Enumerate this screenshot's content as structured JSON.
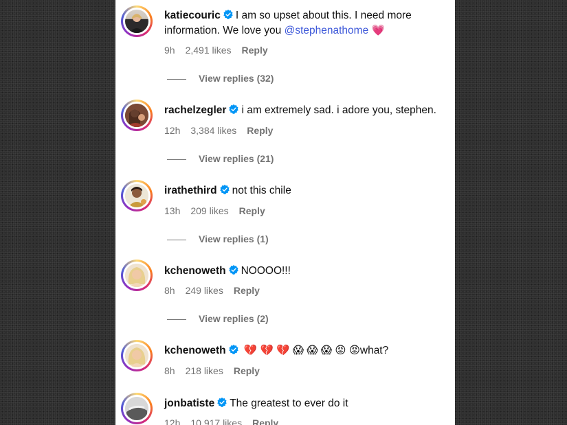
{
  "comments": [
    {
      "username": "katiecouric",
      "text_line1": "I am so upset about this. I need more",
      "text_line2": "information. We love you ",
      "mention": "@stephenathome",
      "emoji": "💗",
      "time": "9h",
      "likes": "2,491 likes",
      "reply": "Reply",
      "view_replies": "View replies (32)"
    },
    {
      "username": "rachelzegler",
      "text": "i am extremely sad. i adore you, stephen.",
      "time": "12h",
      "likes": "3,384 likes",
      "reply": "Reply",
      "view_replies": "View replies (21)"
    },
    {
      "username": "irathethird",
      "text": "not this chile",
      "time": "13h",
      "likes": "209 likes",
      "reply": "Reply",
      "view_replies": "View replies (1)"
    },
    {
      "username": "kchenoweth",
      "text": "NOOOO!!!",
      "time": "8h",
      "likes": "249 likes",
      "reply": "Reply",
      "view_replies": "View replies (2)"
    },
    {
      "username": "kchenoweth",
      "emojis": [
        "💔",
        "💔",
        "💔",
        "😱",
        "😱",
        "😱",
        "😡",
        "😡"
      ],
      "text": "what?",
      "time": "8h",
      "likes": "218 likes",
      "reply": "Reply"
    },
    {
      "username": "jonbatiste",
      "text": "The greatest to ever do it",
      "time": "12h",
      "likes": "10,917 likes",
      "reply": "Reply"
    }
  ],
  "colors": {
    "verified": "#0095f6",
    "mention": "#3e59d9",
    "meta": "#737373"
  },
  "icons": {
    "verified": "verified-badge-icon",
    "heart": "pink-heart-icon"
  }
}
